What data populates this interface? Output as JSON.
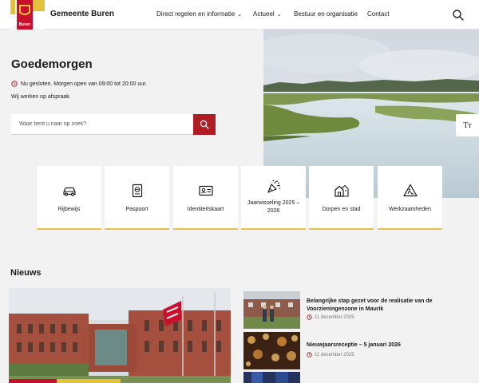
{
  "header": {
    "brand": "Gemeente Buren",
    "logo_text": "Buren",
    "nav": [
      {
        "label": "Direct regelen en informatie",
        "has_dropdown": true
      },
      {
        "label": "Actueel",
        "has_dropdown": true
      },
      {
        "label": "Bestuur en organisatie",
        "has_dropdown": false
      },
      {
        "label": "Contact",
        "has_dropdown": false
      }
    ],
    "search_icon": "search-icon"
  },
  "hero": {
    "greeting": "Goedemorgen",
    "status": "Nu gesloten. Morgen open van 09:00 tot 20:00 uur.",
    "appointment": "Wij werken op afspraak.",
    "search_placeholder": "Waar bent u naar op zoek?",
    "text_size_label": "Tт"
  },
  "tiles": [
    {
      "label": "Rijbewijs",
      "icon": "car-icon"
    },
    {
      "label": "Paspoort",
      "icon": "passport-icon"
    },
    {
      "label": "Identiteitskaart",
      "icon": "id-card-icon"
    },
    {
      "label": "Jaarwisseling 2025 – 2026",
      "icon": "party-popper-icon"
    },
    {
      "label": "Dorpen en stad",
      "icon": "village-icon"
    },
    {
      "label": "Werkzaamheden",
      "icon": "roadwork-icon"
    }
  ],
  "news": {
    "title": "Nieuws",
    "items": [
      {
        "headline": "Belangrijke stap gezet voor de realisatie van de Voorzieningenzone in Maurik",
        "date": "11 december 2025"
      },
      {
        "headline": "Nieuwjaarsreceptie – 5 januari 2026",
        "date": "11 december 2025"
      }
    ]
  },
  "colors": {
    "accent": "#b01c24",
    "tile_border": "#e8c04a",
    "background": "#f2f2f2"
  }
}
